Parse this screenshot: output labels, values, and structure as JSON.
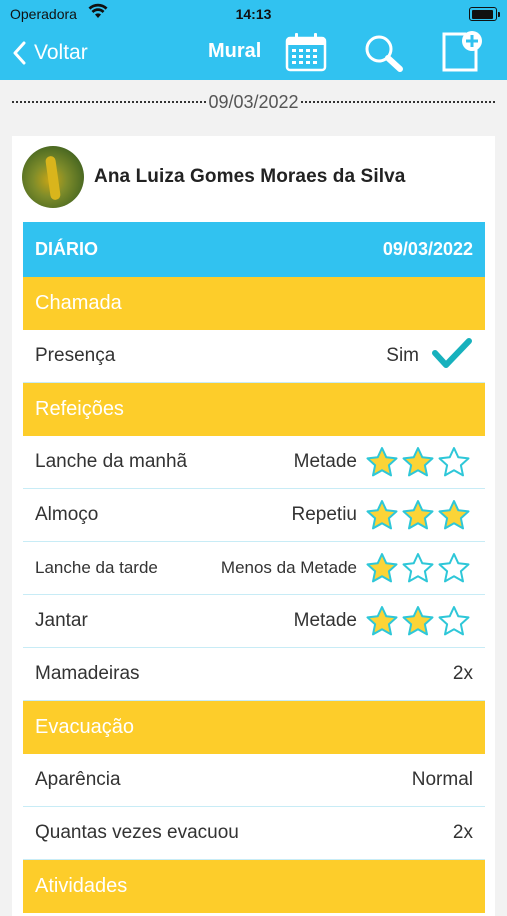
{
  "status_bar": {
    "carrier": "Operadora",
    "time": "14:13"
  },
  "nav": {
    "back_label": "Voltar",
    "title": "Mural"
  },
  "date_separator": "09/03/2022",
  "post": {
    "author": "Ana Luiza Gomes Moraes da Silva",
    "header": {
      "left": "DIÁRIO",
      "right": "09/03/2022"
    },
    "sections": {
      "chamada": "Chamada",
      "refeicoes": "Refeições",
      "evacuacao": "Evacuação",
      "atividades": "Atividades"
    },
    "presenca": {
      "label": "Presença",
      "value": "Sim"
    },
    "meals": [
      {
        "label": "Lanche da manhã",
        "value": "Metade",
        "rating": 2
      },
      {
        "label": "Almoço",
        "value": "Repetiu",
        "rating": 3
      },
      {
        "label": "Lanche da tarde",
        "value": "Menos da Metade",
        "rating": 1
      },
      {
        "label": "Jantar",
        "value": "Metade",
        "rating": 2
      }
    ],
    "mamadeiras": {
      "label": "Mamadeiras",
      "value": "2x"
    },
    "aparencia": {
      "label": "Aparência",
      "value": "Normal"
    },
    "evacuou": {
      "label": "Quantas vezes evacuou",
      "value": "2x"
    }
  },
  "colors": {
    "primary": "#31c2f0",
    "section": "#fdcd2a",
    "star_filled": "#fbd437",
    "star_outline": "#2ec7d8",
    "check": "#17b1bd"
  }
}
